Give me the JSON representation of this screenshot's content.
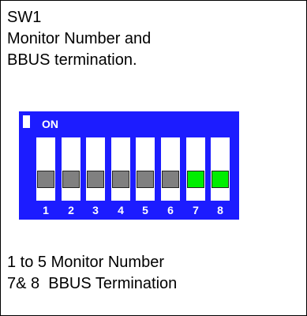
{
  "header": {
    "line1": "SW1",
    "line2": "Monitor Number and",
    "line3": "BBUS termination."
  },
  "dip_switch": {
    "on_label": "ON",
    "colors": {
      "body": "#1c1cff",
      "off_knob": "#808080",
      "on_knob": "#00ee00"
    },
    "switches": [
      {
        "number": "1",
        "state": "off"
      },
      {
        "number": "2",
        "state": "off"
      },
      {
        "number": "3",
        "state": "off"
      },
      {
        "number": "4",
        "state": "off"
      },
      {
        "number": "5",
        "state": "off"
      },
      {
        "number": "6",
        "state": "off"
      },
      {
        "number": "7",
        "state": "on"
      },
      {
        "number": "8",
        "state": "on"
      }
    ]
  },
  "notes": {
    "line1": "1 to 5 Monitor Number",
    "line2": "7& 8  BBUS Termination"
  }
}
